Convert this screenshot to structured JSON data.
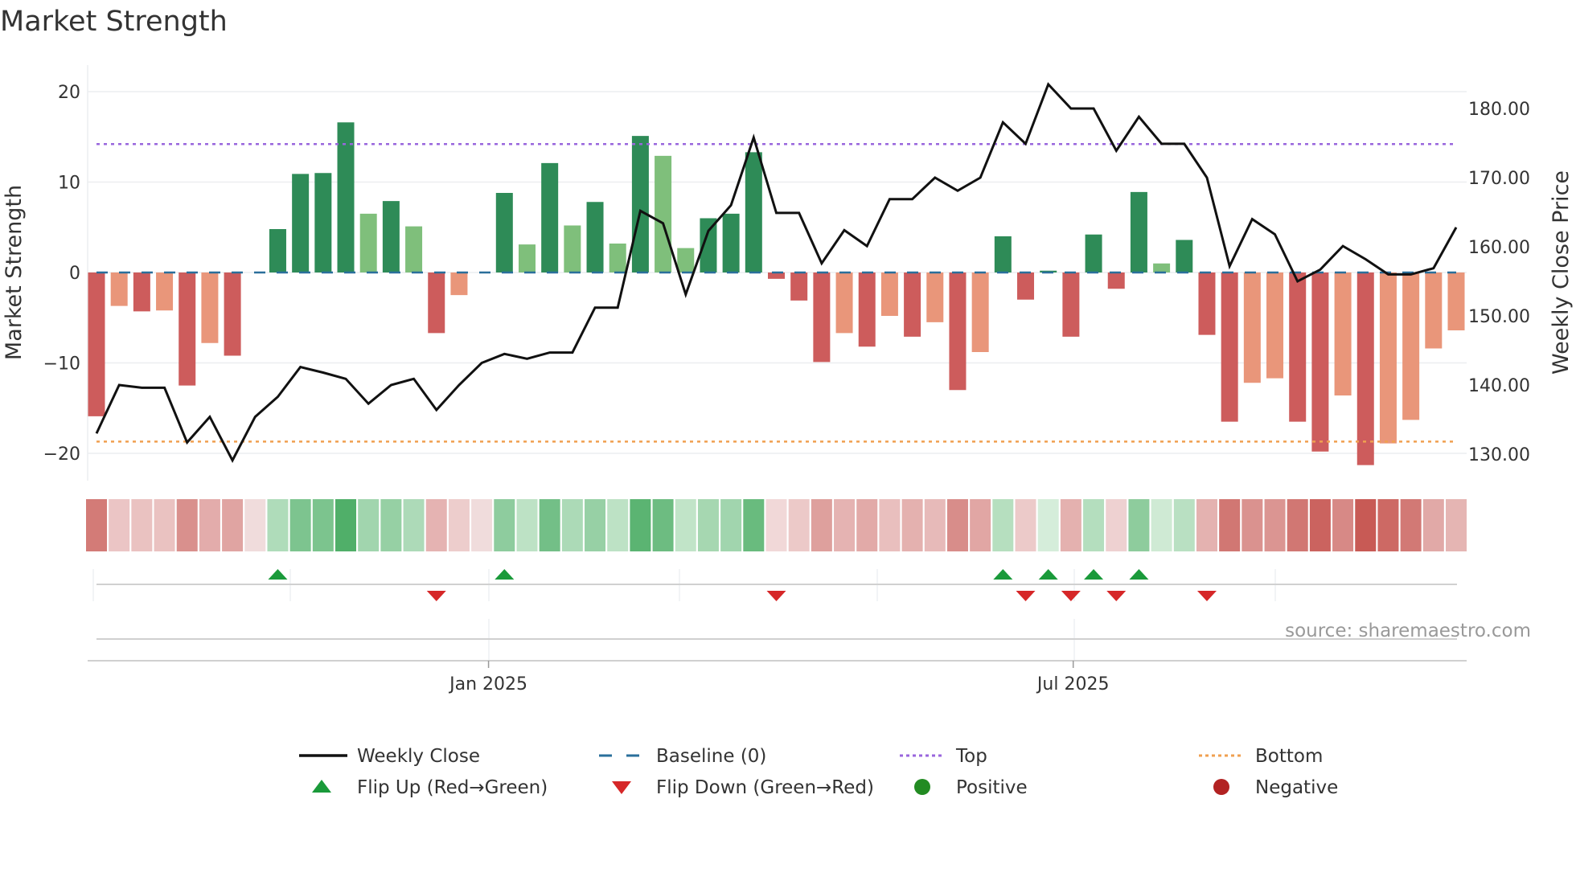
{
  "title": "Market Strength",
  "source": "source: sharemaestro.com",
  "colors": {
    "pos_strong": "#2e8b57",
    "pos_weak": "#7fbf7b",
    "neg_strong": "#cd5c5c",
    "neg_weak": "#e9967a",
    "top": "#9966dd",
    "bottom": "#f0a050",
    "baseline": "#2a6f9b",
    "flip_up": "#1a9a3a",
    "flip_down": "#d62728",
    "positive": "#228b22",
    "negative": "#b22222"
  },
  "chart_data": {
    "type": "bar+line",
    "title": "Market Strength",
    "ylabel": "Market Strength",
    "y2label": "Weekly Close Price",
    "ylim": [
      -23,
      23
    ],
    "y2lim": [
      126,
      186
    ],
    "yticks": [
      "20",
      "10",
      "0",
      "−10",
      "−20"
    ],
    "ytick_values": [
      20,
      10,
      0,
      -10,
      -20
    ],
    "y2ticks": [
      "180.00",
      "170.00",
      "160.00",
      "150.00",
      "140.00",
      "130.00"
    ],
    "y2tick_values": [
      180,
      170,
      160,
      150,
      140,
      130
    ],
    "x_ticks": [
      {
        "label": "Jan 2025",
        "index": 17.3
      },
      {
        "label": "Jul 2025",
        "index": 43.1
      }
    ],
    "top": 14.2,
    "bottom": -18.7,
    "baseline": 0,
    "strength": [
      -15.9,
      -3.7,
      -4.3,
      -4.2,
      -12.5,
      -7.8,
      -9.2,
      0,
      4.8,
      10.9,
      11.0,
      16.6,
      6.5,
      7.9,
      5.1,
      -6.7,
      -2.5,
      0,
      8.8,
      3.1,
      12.1,
      5.2,
      7.8,
      3.2,
      15.1,
      12.9,
      2.7,
      6.0,
      6.5,
      13.3,
      -0.7,
      -3.1,
      -9.9,
      -6.7,
      -8.2,
      -4.8,
      -7.1,
      -5.5,
      -13.0,
      -8.8,
      4.0,
      -3.0,
      0.2,
      -7.1,
      4.2,
      -1.8,
      8.9,
      1.0,
      3.6,
      -6.9,
      -16.5,
      -12.2,
      -11.7,
      -16.5,
      -19.8,
      -13.6,
      -21.3,
      -18.9,
      -16.3,
      -8.4,
      -6.4
    ],
    "weekly_close": [
      133.0,
      140.0,
      139.6,
      139.6,
      131.7,
      135.4,
      129.1,
      135.4,
      138.3,
      142.6,
      141.8,
      140.9,
      137.3,
      140.0,
      140.9,
      136.4,
      140.0,
      143.2,
      144.5,
      143.8,
      144.7,
      144.7,
      151.2,
      151.2,
      165.2,
      163.4,
      153.1,
      162.3,
      166.0,
      175.8,
      164.9,
      164.9,
      157.6,
      162.4,
      160.1,
      166.9,
      166.9,
      170.0,
      168.1,
      170.0,
      178.0,
      174.9,
      183.5,
      180.0,
      180.0,
      173.9,
      178.8,
      174.9,
      174.9,
      170.0,
      157.2,
      164.0,
      161.8,
      155.0,
      156.7,
      160.1,
      158.2,
      156.0,
      156.0,
      156.9,
      162.8
    ],
    "flip_up_indices": [
      8,
      18,
      40,
      42,
      44,
      46
    ],
    "flip_down_indices": [
      15,
      30,
      41,
      43,
      45,
      49
    ]
  },
  "legend": [
    {
      "label": "Weekly Close",
      "kind": "line"
    },
    {
      "label": "Baseline (0)",
      "kind": "dash"
    },
    {
      "label": "Top",
      "kind": "dot-top"
    },
    {
      "label": "Bottom",
      "kind": "dot-bottom"
    },
    {
      "label": "Flip Up (Red→Green)",
      "kind": "tri-up"
    },
    {
      "label": "Flip Down (Green→Red)",
      "kind": "tri-down"
    },
    {
      "label": "Positive",
      "kind": "circle-pos"
    },
    {
      "label": "Negative",
      "kind": "circle-neg"
    }
  ]
}
